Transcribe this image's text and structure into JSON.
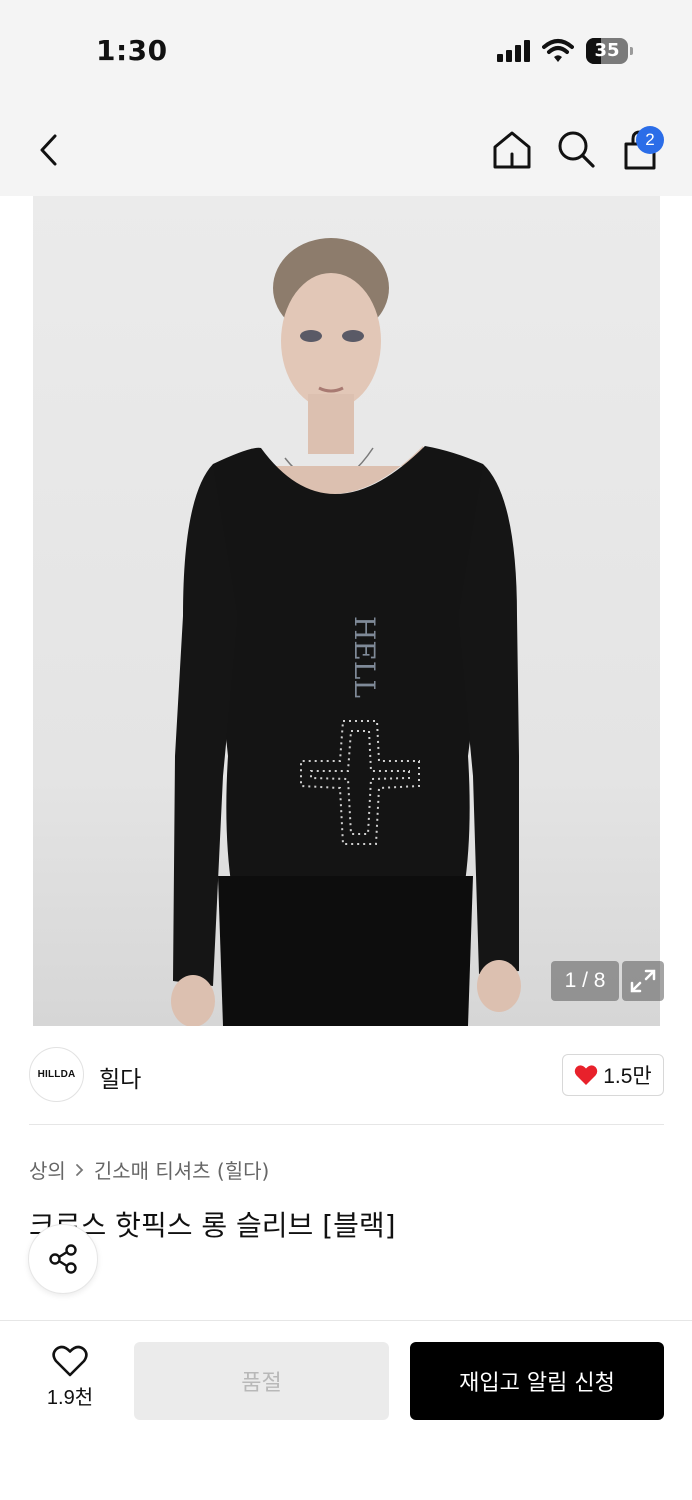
{
  "status_bar": {
    "time": "1:30",
    "battery": "35"
  },
  "nav": {
    "cart_count": "2",
    "icons": [
      "chevron-left-icon",
      "home-icon",
      "search-icon",
      "shopping-bag-icon"
    ]
  },
  "gallery": {
    "counter": "1 / 8"
  },
  "brand": {
    "logo_text": "HILLDA",
    "name": "힐다",
    "likes": "1.5만"
  },
  "breadcrumb": {
    "category": "상의",
    "sub_category": "긴소매 티셔츠 (힐다)"
  },
  "product": {
    "title": "크로스 핫픽스 롱 슬리브 [블랙]"
  },
  "bottom_bar": {
    "wish_count": "1.9천",
    "soldout_label": "품절",
    "restock_label": "재입고 알림 신청"
  },
  "colors": {
    "accent_badge": "#2b6de8",
    "heart": "#e8212b",
    "primary_button": "#000000"
  }
}
